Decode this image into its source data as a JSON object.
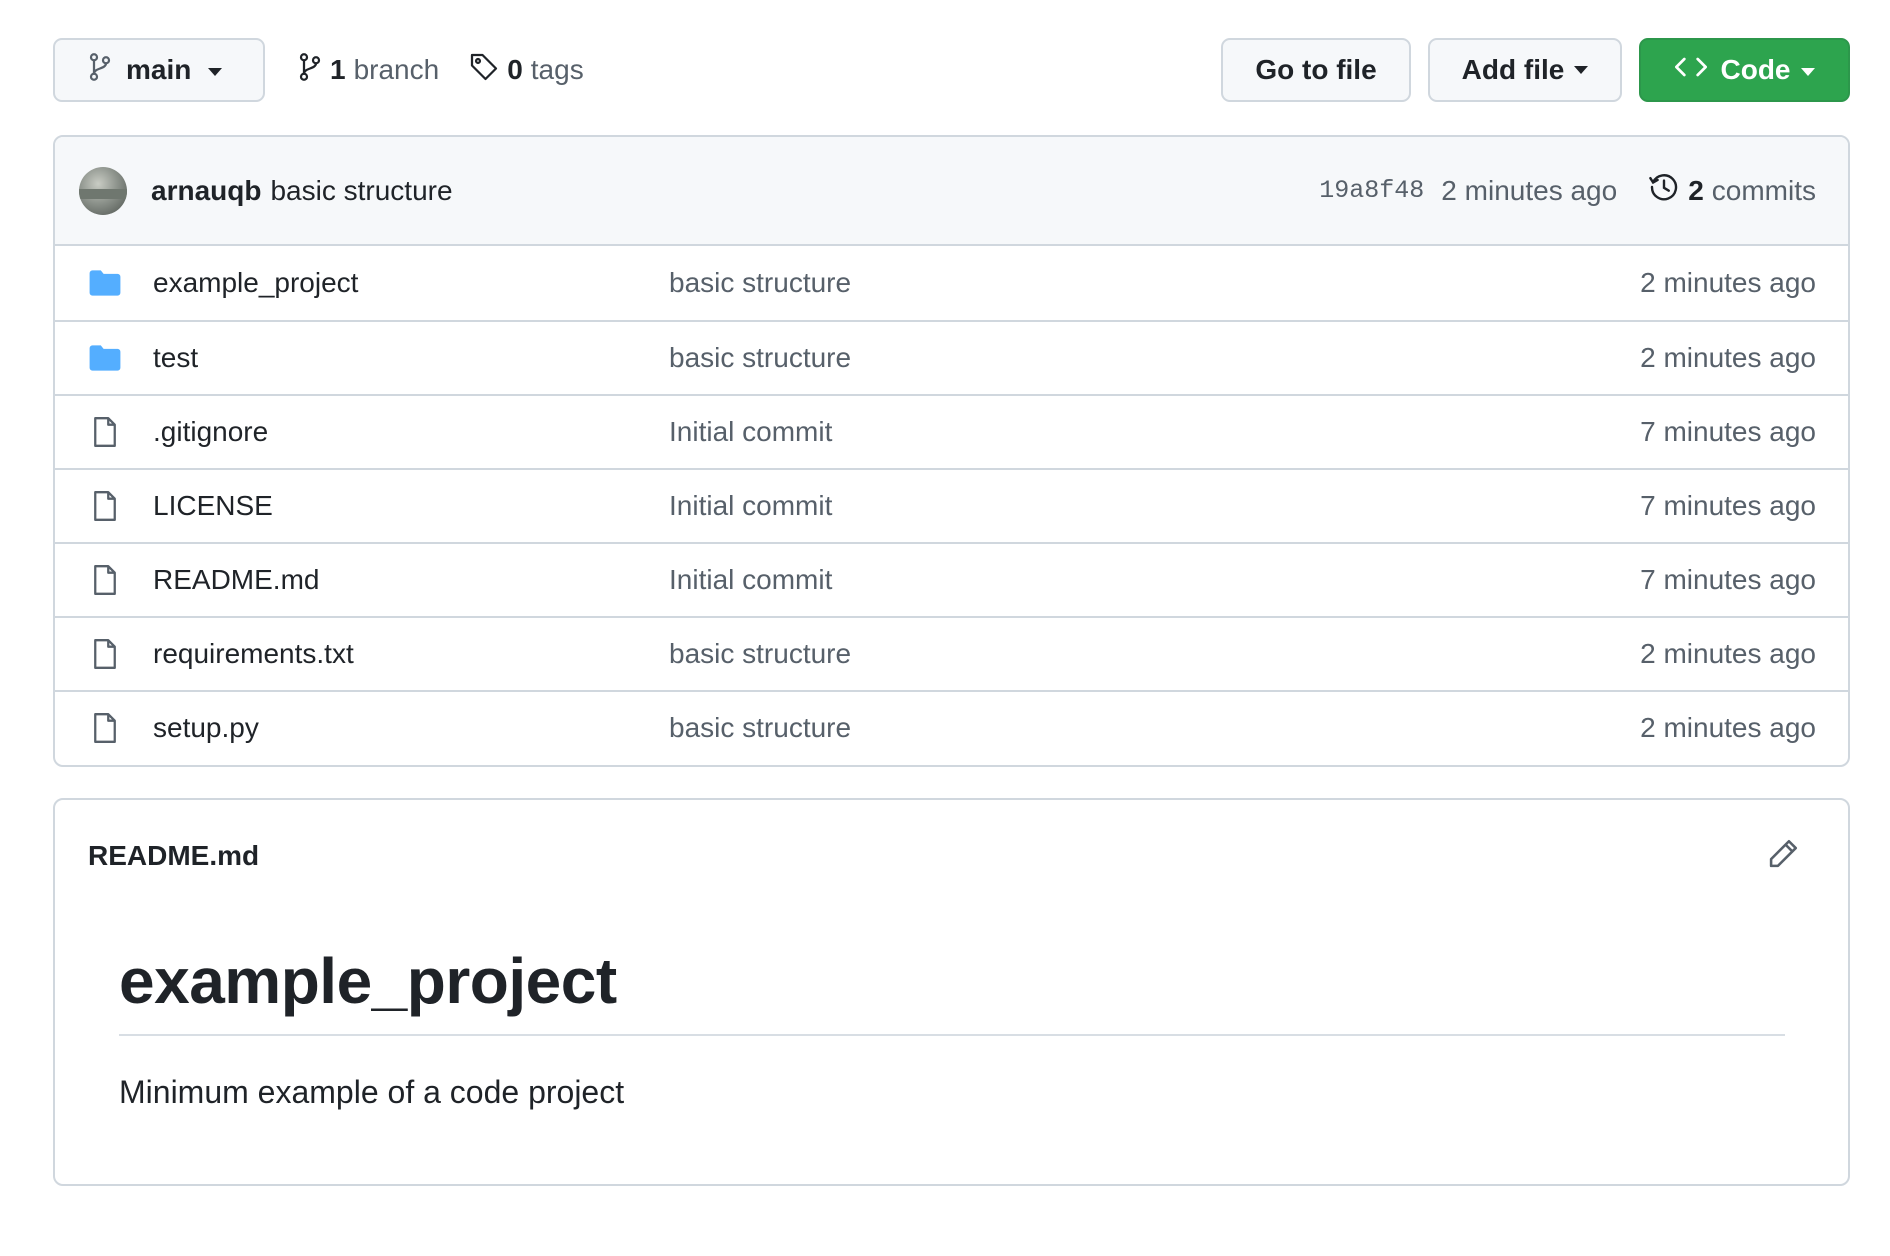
{
  "toolbar": {
    "branch_name": "main",
    "branch_count": "1",
    "branch_label": "branch",
    "tag_count": "0",
    "tag_label": "tags",
    "go_to_file_label": "Go to file",
    "add_file_label": "Add file",
    "code_label": "Code"
  },
  "latest_commit": {
    "author": "arnauqb",
    "message": "basic structure",
    "sha": "19a8f48",
    "time": "2 minutes ago",
    "commit_count": "2",
    "commit_label": "commits"
  },
  "files": [
    {
      "name": "example_project",
      "type": "folder",
      "message": "basic structure",
      "time": "2 minutes ago"
    },
    {
      "name": "test",
      "type": "folder",
      "message": "basic structure",
      "time": "2 minutes ago"
    },
    {
      "name": ".gitignore",
      "type": "file",
      "message": "Initial commit",
      "time": "7 minutes ago"
    },
    {
      "name": "LICENSE",
      "type": "file",
      "message": "Initial commit",
      "time": "7 minutes ago"
    },
    {
      "name": "README.md",
      "type": "file",
      "message": "Initial commit",
      "time": "7 minutes ago"
    },
    {
      "name": "requirements.txt",
      "type": "file",
      "message": "basic structure",
      "time": "2 minutes ago"
    },
    {
      "name": "setup.py",
      "type": "file",
      "message": "basic structure",
      "time": "2 minutes ago"
    }
  ],
  "readme": {
    "filename": "README.md",
    "heading": "example_project",
    "text": "Minimum example of a code project"
  },
  "colors": {
    "code_button": "#2da44e",
    "folder_icon": "#54aeff",
    "border": "#d0d7de",
    "muted_text": "#57606a"
  }
}
